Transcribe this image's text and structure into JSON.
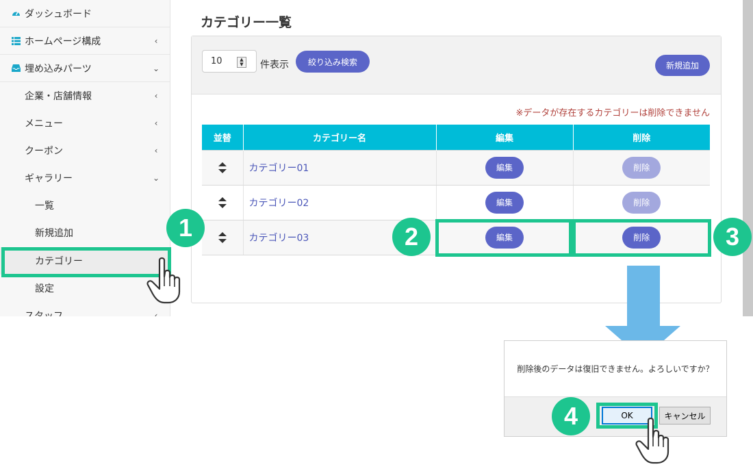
{
  "sidebar": {
    "items": [
      {
        "label": "ダッシュボード",
        "icon": "dashboard-icon"
      },
      {
        "label": "ホームページ構成",
        "icon": "list-icon",
        "chevron": "‹"
      },
      {
        "label": "埋め込みパーツ",
        "icon": "inbox-icon",
        "chevron": "›"
      },
      {
        "label": "企業・店舗情報",
        "chevron": "‹"
      },
      {
        "label": "メニュー",
        "chevron": "‹"
      },
      {
        "label": "クーポン",
        "chevron": "‹"
      },
      {
        "label": "ギャラリー",
        "chevron": "›"
      },
      {
        "label": "一覧"
      },
      {
        "label": "新規追加"
      },
      {
        "label": "カテゴリー"
      },
      {
        "label": "設定"
      },
      {
        "label": "スタッフ",
        "chevron": "‹"
      }
    ]
  },
  "page": {
    "title": "カテゴリー一覧",
    "per_page_value": "10",
    "per_page_label": "件表示",
    "filter_button": "絞り込み検索",
    "add_button": "新規追加",
    "note": "※データが存在するカテゴリーは削除できません"
  },
  "table": {
    "headers": [
      "並替",
      "カテゴリー名",
      "編集",
      "削除"
    ],
    "rows": [
      {
        "name": "カテゴリー01",
        "edit": "編集",
        "delete": "削除",
        "delete_enabled": false
      },
      {
        "name": "カテゴリー02",
        "edit": "編集",
        "delete": "削除",
        "delete_enabled": false
      },
      {
        "name": "カテゴリー03",
        "edit": "編集",
        "delete": "削除",
        "delete_enabled": true
      }
    ]
  },
  "dialog": {
    "message": "削除後のデータは復旧できません。よろしいですか？",
    "ok": "OK",
    "cancel": "キャンセル"
  },
  "annotations": {
    "steps": [
      "1",
      "2",
      "3",
      "4"
    ]
  },
  "colors": {
    "accent": "#5b65c8",
    "accent_disabled": "#a3a8de",
    "table_header": "#00bcd8",
    "highlight": "#1dc58f",
    "note": "#b0403a",
    "arrow": "#6bb8e8"
  }
}
